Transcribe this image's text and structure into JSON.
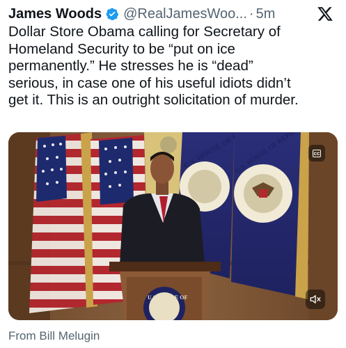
{
  "author": {
    "name": "James Woods",
    "handle": "@RealJamesWoo...",
    "separator": "·",
    "time": "5m",
    "verified_color": "#1d9bf0"
  },
  "tweet": {
    "text": "Dollar Store Obama calling for Secretary of\nHomeland Security to be “put on ice\npermanently.”  He stresses he is “dead”\nserious, in case one of his useful idiots didn’t\nget it. This is an outright solicitation of murder."
  },
  "media": {
    "cc_label": "cc",
    "seal_text_1": "U.S. HOUSE OF REPRE",
    "seal_text_2": "U.S. HOUSE OF REPRESENTATIVES",
    "podium_seal_text": "U.S. HOUSE OF"
  },
  "source": {
    "text": "From Bill Melugin"
  },
  "icons": [
    "verified-badge-icon",
    "x-logo-icon",
    "closed-captions-icon",
    "muted-speaker-icon"
  ]
}
